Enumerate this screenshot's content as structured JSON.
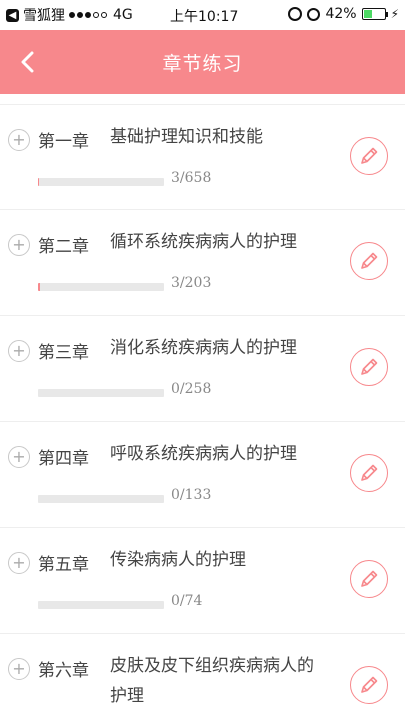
{
  "status": {
    "carrier": "雪狐狸",
    "network": "4G",
    "time": "上午10:17",
    "battery": "42%",
    "battery_level": 0.42,
    "signal_bars_on": 3,
    "signal_bars_total": 5
  },
  "nav": {
    "title": "章节练习"
  },
  "colors": {
    "accent": "#f7888c",
    "track": "#e8e8e8"
  },
  "chapters": [
    {
      "no": "第一章",
      "title": "基础护理知识和技能",
      "done": 3,
      "total": 658,
      "progress": "3/658"
    },
    {
      "no": "第二章",
      "title": "循环系统疾病病人的护理",
      "done": 3,
      "total": 203,
      "progress": "3/203"
    },
    {
      "no": "第三章",
      "title": "消化系统疾病病人的护理",
      "done": 0,
      "total": 258,
      "progress": "0/258"
    },
    {
      "no": "第四章",
      "title": "呼吸系统疾病病人的护理",
      "done": 0,
      "total": 133,
      "progress": "0/133"
    },
    {
      "no": "第五章",
      "title": "传染病病人的护理",
      "done": 0,
      "total": 74,
      "progress": "0/74"
    },
    {
      "no": "第六章",
      "title": "皮肤及皮下组织疾病病人的护理",
      "done": null,
      "total": null,
      "progress": null
    }
  ]
}
